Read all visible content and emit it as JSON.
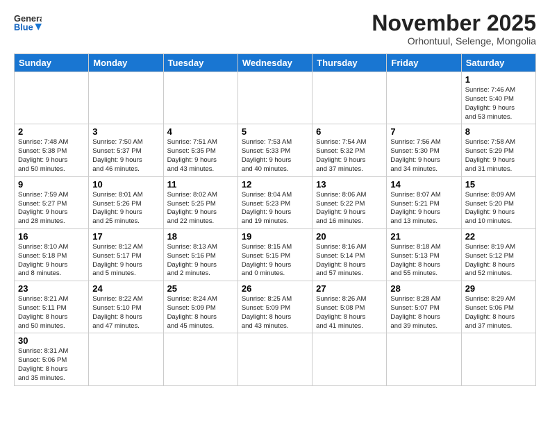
{
  "logo": {
    "line1": "General",
    "line2": "Blue"
  },
  "title": "November 2025",
  "subtitle": "Orhontuul, Selenge, Mongolia",
  "weekdays": [
    "Sunday",
    "Monday",
    "Tuesday",
    "Wednesday",
    "Thursday",
    "Friday",
    "Saturday"
  ],
  "weeks": [
    [
      {
        "date": "",
        "info": ""
      },
      {
        "date": "",
        "info": ""
      },
      {
        "date": "",
        "info": ""
      },
      {
        "date": "",
        "info": ""
      },
      {
        "date": "",
        "info": ""
      },
      {
        "date": "",
        "info": ""
      },
      {
        "date": "1",
        "info": "Sunrise: 7:46 AM\nSunset: 5:40 PM\nDaylight: 9 hours\nand 53 minutes."
      }
    ],
    [
      {
        "date": "2",
        "info": "Sunrise: 7:48 AM\nSunset: 5:38 PM\nDaylight: 9 hours\nand 50 minutes."
      },
      {
        "date": "3",
        "info": "Sunrise: 7:50 AM\nSunset: 5:37 PM\nDaylight: 9 hours\nand 46 minutes."
      },
      {
        "date": "4",
        "info": "Sunrise: 7:51 AM\nSunset: 5:35 PM\nDaylight: 9 hours\nand 43 minutes."
      },
      {
        "date": "5",
        "info": "Sunrise: 7:53 AM\nSunset: 5:33 PM\nDaylight: 9 hours\nand 40 minutes."
      },
      {
        "date": "6",
        "info": "Sunrise: 7:54 AM\nSunset: 5:32 PM\nDaylight: 9 hours\nand 37 minutes."
      },
      {
        "date": "7",
        "info": "Sunrise: 7:56 AM\nSunset: 5:30 PM\nDaylight: 9 hours\nand 34 minutes."
      },
      {
        "date": "8",
        "info": "Sunrise: 7:58 AM\nSunset: 5:29 PM\nDaylight: 9 hours\nand 31 minutes."
      }
    ],
    [
      {
        "date": "9",
        "info": "Sunrise: 7:59 AM\nSunset: 5:27 PM\nDaylight: 9 hours\nand 28 minutes."
      },
      {
        "date": "10",
        "info": "Sunrise: 8:01 AM\nSunset: 5:26 PM\nDaylight: 9 hours\nand 25 minutes."
      },
      {
        "date": "11",
        "info": "Sunrise: 8:02 AM\nSunset: 5:25 PM\nDaylight: 9 hours\nand 22 minutes."
      },
      {
        "date": "12",
        "info": "Sunrise: 8:04 AM\nSunset: 5:23 PM\nDaylight: 9 hours\nand 19 minutes."
      },
      {
        "date": "13",
        "info": "Sunrise: 8:06 AM\nSunset: 5:22 PM\nDaylight: 9 hours\nand 16 minutes."
      },
      {
        "date": "14",
        "info": "Sunrise: 8:07 AM\nSunset: 5:21 PM\nDaylight: 9 hours\nand 13 minutes."
      },
      {
        "date": "15",
        "info": "Sunrise: 8:09 AM\nSunset: 5:20 PM\nDaylight: 9 hours\nand 10 minutes."
      }
    ],
    [
      {
        "date": "16",
        "info": "Sunrise: 8:10 AM\nSunset: 5:18 PM\nDaylight: 9 hours\nand 8 minutes."
      },
      {
        "date": "17",
        "info": "Sunrise: 8:12 AM\nSunset: 5:17 PM\nDaylight: 9 hours\nand 5 minutes."
      },
      {
        "date": "18",
        "info": "Sunrise: 8:13 AM\nSunset: 5:16 PM\nDaylight: 9 hours\nand 2 minutes."
      },
      {
        "date": "19",
        "info": "Sunrise: 8:15 AM\nSunset: 5:15 PM\nDaylight: 9 hours\nand 0 minutes."
      },
      {
        "date": "20",
        "info": "Sunrise: 8:16 AM\nSunset: 5:14 PM\nDaylight: 8 hours\nand 57 minutes."
      },
      {
        "date": "21",
        "info": "Sunrise: 8:18 AM\nSunset: 5:13 PM\nDaylight: 8 hours\nand 55 minutes."
      },
      {
        "date": "22",
        "info": "Sunrise: 8:19 AM\nSunset: 5:12 PM\nDaylight: 8 hours\nand 52 minutes."
      }
    ],
    [
      {
        "date": "23",
        "info": "Sunrise: 8:21 AM\nSunset: 5:11 PM\nDaylight: 8 hours\nand 50 minutes."
      },
      {
        "date": "24",
        "info": "Sunrise: 8:22 AM\nSunset: 5:10 PM\nDaylight: 8 hours\nand 47 minutes."
      },
      {
        "date": "25",
        "info": "Sunrise: 8:24 AM\nSunset: 5:09 PM\nDaylight: 8 hours\nand 45 minutes."
      },
      {
        "date": "26",
        "info": "Sunrise: 8:25 AM\nSunset: 5:09 PM\nDaylight: 8 hours\nand 43 minutes."
      },
      {
        "date": "27",
        "info": "Sunrise: 8:26 AM\nSunset: 5:08 PM\nDaylight: 8 hours\nand 41 minutes."
      },
      {
        "date": "28",
        "info": "Sunrise: 8:28 AM\nSunset: 5:07 PM\nDaylight: 8 hours\nand 39 minutes."
      },
      {
        "date": "29",
        "info": "Sunrise: 8:29 AM\nSunset: 5:06 PM\nDaylight: 8 hours\nand 37 minutes."
      }
    ],
    [
      {
        "date": "30",
        "info": "Sunrise: 8:31 AM\nSunset: 5:06 PM\nDaylight: 8 hours\nand 35 minutes."
      },
      {
        "date": "",
        "info": ""
      },
      {
        "date": "",
        "info": ""
      },
      {
        "date": "",
        "info": ""
      },
      {
        "date": "",
        "info": ""
      },
      {
        "date": "",
        "info": ""
      },
      {
        "date": "",
        "info": ""
      }
    ]
  ]
}
